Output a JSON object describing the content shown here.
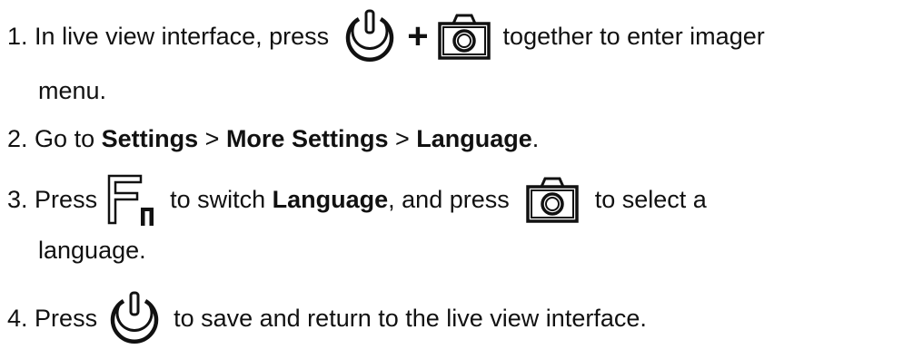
{
  "steps": [
    {
      "num": "1.",
      "pre": "In live view interface, press",
      "plus": "+",
      "post": "together to enter imager",
      "cont": "menu.",
      "icons": [
        "power-button-icon",
        "camera-button-icon"
      ]
    },
    {
      "num": "2.",
      "pre": "Go to",
      "b1": "Settings",
      "sep1": ">",
      "b2": "More Settings",
      "sep2": ">",
      "b3": "Language",
      "end": "."
    },
    {
      "num": "3.",
      "pre": "Press",
      "mid1": "to switch",
      "b1": "Language",
      "mid2": ", and press",
      "post": "to select a",
      "cont": "language.",
      "icons": [
        "fn-button-icon",
        "camera-button-icon"
      ]
    },
    {
      "num": "4.",
      "pre": "Press",
      "post": "to save and return to the live view interface.",
      "icons": [
        "power-button-icon"
      ]
    }
  ]
}
